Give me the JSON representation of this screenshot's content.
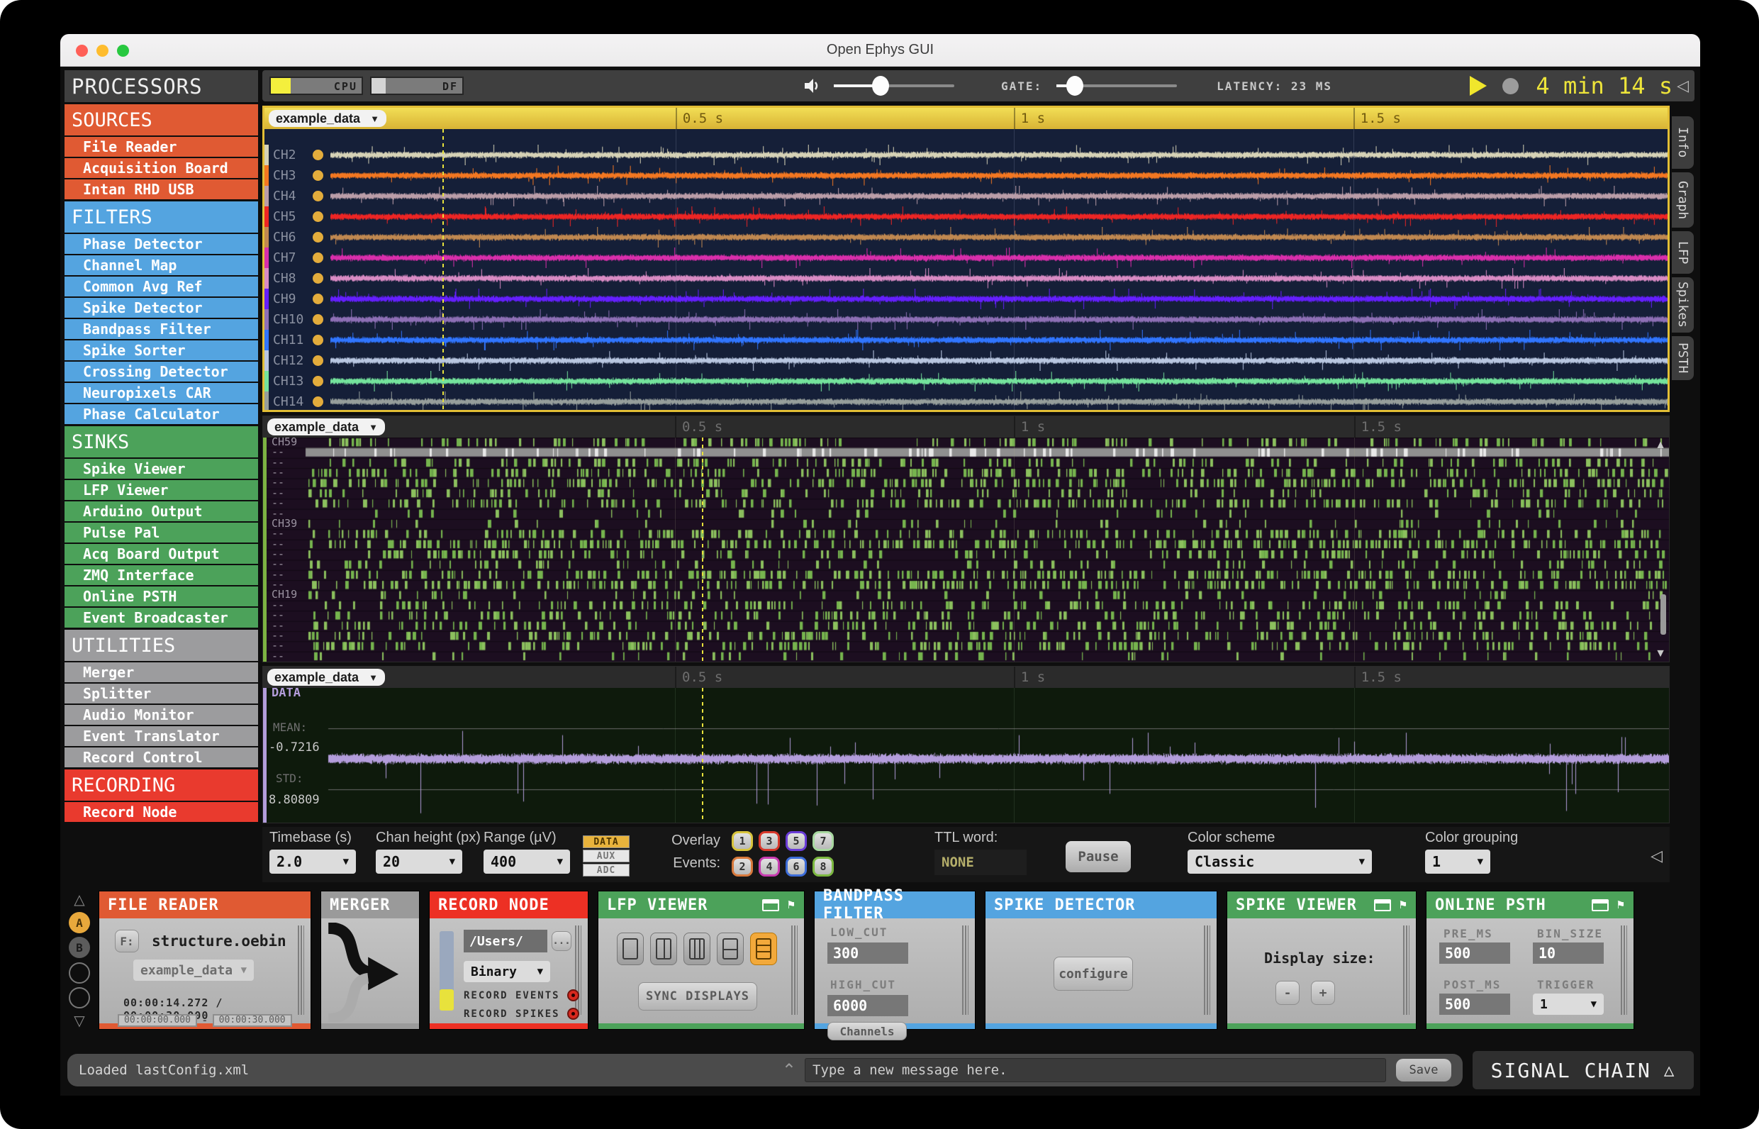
{
  "window": {
    "title": "Open Ephys GUI"
  },
  "sidebar": {
    "title": "PROCESSORS",
    "sections": [
      {
        "label": "SOURCES",
        "color": "#E05A33",
        "items": [
          "File Reader",
          "Acquisition Board",
          "Intan RHD USB"
        ]
      },
      {
        "label": "FILTERS",
        "color": "#54A4E0",
        "items": [
          "Phase Detector",
          "Channel Map",
          "Common Avg Ref",
          "Spike Detector",
          "Bandpass Filter",
          "Spike Sorter",
          "Crossing Detector",
          "Neuropixels CAR",
          "Phase Calculator"
        ]
      },
      {
        "label": "SINKS",
        "color": "#4CA25A",
        "items": [
          "Spike Viewer",
          "LFP Viewer",
          "Arduino Output",
          "Pulse Pal",
          "Acq Board Output",
          "ZMQ Interface",
          "Online PSTH",
          "Event Broadcaster"
        ]
      },
      {
        "label": "UTILITIES",
        "color": "#9C9C9E",
        "items": [
          "Merger",
          "Splitter",
          "Audio Monitor",
          "Event Translator",
          "Record Control"
        ]
      },
      {
        "label": "RECORDING",
        "color": "#E93A2E",
        "items": [
          "Record Node"
        ]
      }
    ]
  },
  "topbar": {
    "cpu_label": "CPU",
    "cpu_fill": 22,
    "df_label": "DF",
    "df_fill": 16,
    "gate_label": "GATE:",
    "latency": "LATENCY: 23 MS",
    "timer": "4 min 14 s",
    "accent_yellow": "#EDE43A"
  },
  "viewers": {
    "source_label": "example_data",
    "time_ticks": [
      "0.5 s",
      "1 s",
      "1.5 s"
    ],
    "tick_fracs": [
      0.293,
      0.534,
      0.776
    ],
    "lfp": {
      "channels": [
        {
          "name": "CH2",
          "color": "#D6D2B6"
        },
        {
          "name": "CH3",
          "color": "#F37721"
        },
        {
          "name": "CH4",
          "color": "#BA9DA8"
        },
        {
          "name": "CH5",
          "color": "#ED2524"
        },
        {
          "name": "CH6",
          "color": "#C08850"
        },
        {
          "name": "CH7",
          "color": "#D92EAB"
        },
        {
          "name": "CH8",
          "color": "#D98BC4"
        },
        {
          "name": "CH9",
          "color": "#651FFF"
        },
        {
          "name": "CH10",
          "color": "#8D6FB5"
        },
        {
          "name": "CH11",
          "color": "#3075FF"
        },
        {
          "name": "CH12",
          "color": "#B8C6E0"
        },
        {
          "name": "CH13",
          "color": "#74E39C"
        },
        {
          "name": "CH14",
          "color": "#969E9B"
        }
      ]
    },
    "raster": {
      "top_label": "CH59",
      "mid_label": "CH39",
      "low_label": "CH19",
      "dash": "--",
      "tick_color": "#8CC05E",
      "strip_color": "#7CB342"
    },
    "single": {
      "channel": "DATA",
      "mean_label": "MEAN:",
      "mean": "-0.7216",
      "std_label": "STD:",
      "std": "8.80809",
      "trace_color": "#B39DDB"
    }
  },
  "options": {
    "timebase_label": "Timebase (s)",
    "timebase": "2.0",
    "chan_label": "Chan height (px)",
    "chan": "20",
    "range_label": "Range (µV)",
    "range": "400",
    "signal_types": [
      {
        "label": "DATA",
        "active": true
      },
      {
        "label": "AUX",
        "active": false
      },
      {
        "label": "ADC",
        "active": false
      }
    ],
    "overlay_1": "Overlay",
    "overlay_2": "Events:",
    "events": [
      {
        "n": "1",
        "c": "#D8C43C"
      },
      {
        "n": "3",
        "c": "#D8392C"
      },
      {
        "n": "5",
        "c": "#6A3CD8"
      },
      {
        "n": "7",
        "c": "#A8D8A0"
      },
      {
        "n": "2",
        "c": "#D8793C"
      },
      {
        "n": "4",
        "c": "#C83CB0"
      },
      {
        "n": "6",
        "c": "#3C6CD8"
      },
      {
        "n": "8",
        "c": "#7CB840"
      }
    ],
    "ttl_label": "TTL word:",
    "ttl_value": "NONE",
    "pause": "Pause",
    "scheme_label": "Color scheme",
    "scheme": "Classic",
    "grouping_label": "Color grouping",
    "grouping": "1"
  },
  "right_tabs": [
    "Info",
    "Graph",
    "LFP",
    "Spikes",
    "PSTH"
  ],
  "chain": {
    "io": {
      "a": "A",
      "b": "B"
    },
    "file_reader": {
      "title": "FILE READER",
      "color": "#E05A33",
      "f_label": "F:",
      "file": "structure.oebin",
      "source": "example_data",
      "time": "00:00:14.272 / 00:00:30.000",
      "start": "00:00:00.000",
      "dashsep": "-",
      "end": "00:00:30.000"
    },
    "merger": {
      "title": "MERGER",
      "color": "#9A9A9A"
    },
    "record_node": {
      "title": "RECORD NODE",
      "color": "#ED3024",
      "path": "/Users/",
      "more": "...",
      "engine": "Binary",
      "events_label": "RECORD EVENTS",
      "spikes_label": "RECORD SPIKES"
    },
    "lfp_viewer": {
      "title": "LFP VIEWER",
      "color": "#4CA25A",
      "sync": "SYNC DISPLAYS"
    },
    "bandpass": {
      "title": "BANDPASS FILTER",
      "color": "#54A4E0",
      "low_label": "LOW_CUT",
      "low": "300",
      "high_label": "HIGH_CUT",
      "high": "6000",
      "channels": "Channels"
    },
    "spike_detector": {
      "title": "SPIKE DETECTOR",
      "color": "#54A4E0",
      "configure": "configure"
    },
    "spike_viewer": {
      "title": "SPIKE VIEWER",
      "color": "#4CA25A",
      "display_label": "Display size:",
      "minus": "-",
      "plus": "+"
    },
    "online_psth": {
      "title": "ONLINE PSTH",
      "color": "#4CA25A",
      "pre_label": "PRE_MS",
      "pre": "500",
      "bin_label": "BIN_SIZE",
      "bin": "10",
      "post_label": "POST_MS",
      "post": "500",
      "trigger_label": "TRIGGER",
      "trigger": "1"
    }
  },
  "statusbar": {
    "message": "Loaded lastConfig.xml",
    "input_placeholder": "Type a new message here.",
    "save": "Save",
    "signal_chain": "SIGNAL CHAIN"
  }
}
